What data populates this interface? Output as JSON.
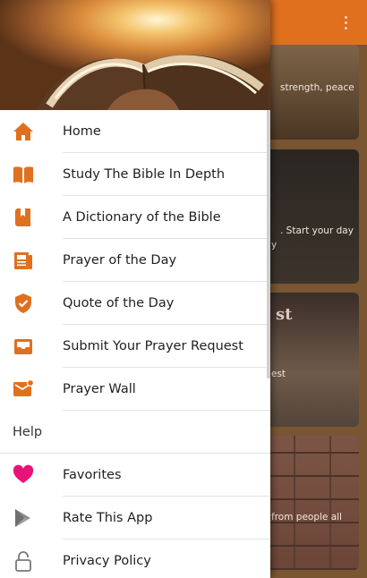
{
  "colors": {
    "accent": "#e0701e",
    "drawer_icon": "#e0701e",
    "favorite_icon": "#e8127a",
    "muted_icon": "#777777"
  },
  "app_bar": {
    "menu_icon": "overflow-menu-icon"
  },
  "drawer": {
    "header_image": "open-bible-sunset-image",
    "items": [
      {
        "label": "Home",
        "icon": "home-icon"
      },
      {
        "label": "Study The Bible In Depth",
        "icon": "book-icon"
      },
      {
        "label": "A Dictionary of the Bible",
        "icon": "bookmark-icon"
      },
      {
        "label": "Prayer of the Day",
        "icon": "newspaper-icon"
      },
      {
        "label": "Quote of the Day",
        "icon": "shield-check-icon"
      },
      {
        "label": "Submit Your Prayer Request",
        "icon": "inbox-tray-icon"
      },
      {
        "label": "Prayer Wall",
        "icon": "email-icon"
      }
    ],
    "section_label": "Help",
    "help_items": [
      {
        "label": "Favorites",
        "icon": "heart-icon"
      },
      {
        "label": "Rate This App",
        "icon": "play-store-icon"
      },
      {
        "label": "Privacy Policy",
        "icon": "lock-icon"
      }
    ]
  },
  "feed": {
    "cards": [
      {
        "text": "strength, peace"
      },
      {
        "text": ". Start your day",
        "text2": "y"
      },
      {
        "text": "est",
        "overlay": "st"
      },
      {
        "text": "from people all"
      }
    ]
  }
}
